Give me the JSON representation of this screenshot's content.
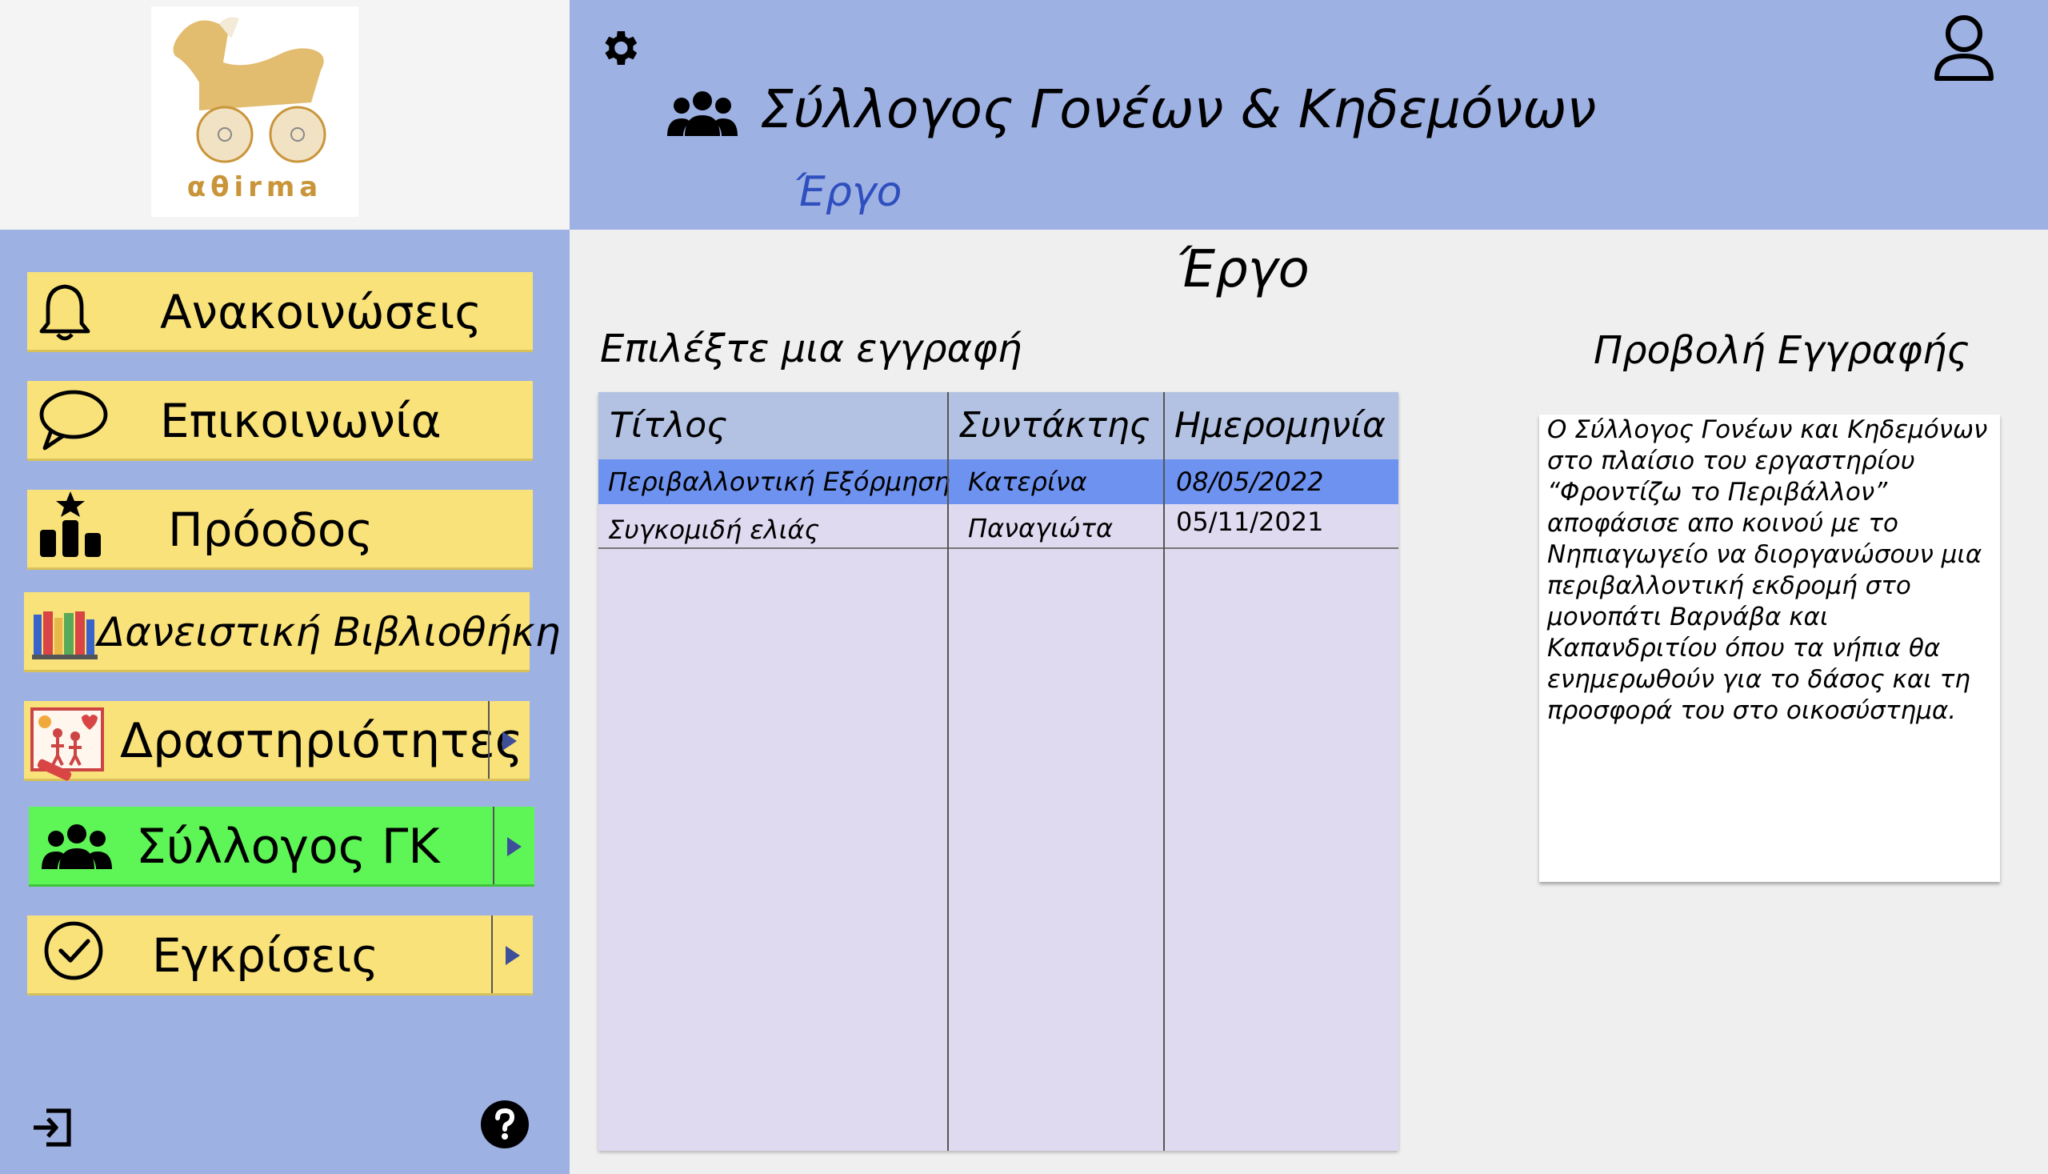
{
  "logo": {
    "text": "αθirma"
  },
  "header": {
    "title": "Σύλλογος Γονέων & Κηδεμόνων",
    "breadcrumb": "Έργο"
  },
  "colors": {
    "header_bg": "#9eb1e3",
    "nav_bg": "#f9e27a",
    "nav_active_bg": "#5ef556",
    "selected_row": "#6e92ef",
    "breadcrumb": "#2f4fbf"
  },
  "sidebar": {
    "items": [
      {
        "label": "Ανακοινώσεις",
        "icon": "bell-icon"
      },
      {
        "label": "Επικοινωνία",
        "icon": "speech-bubble-icon"
      },
      {
        "label": "Πρόοδος",
        "icon": "podium-star-icon"
      },
      {
        "label": "Δανειστική Βιβλιοθήκη",
        "icon": "books-icon"
      },
      {
        "label": "Δραστηριότητες",
        "icon": "drawing-icon",
        "submenu": true
      },
      {
        "label": "Σύλλογος ΓΚ",
        "icon": "group-icon",
        "submenu": true,
        "active": true
      },
      {
        "label": "Εγκρίσεις",
        "icon": "check-circle-icon",
        "submenu": true
      }
    ]
  },
  "main": {
    "page_title": "Έργο",
    "list_heading": "Επιλέξτε μια εγγραφή",
    "preview_heading": "Προβολή Εγγραφής",
    "table": {
      "columns": [
        "Τίτλος",
        "Συντάκτης",
        "Ημερομηνία"
      ],
      "rows": [
        {
          "title": "Περιβαλλοντική Εξόρμηση",
          "author": "Κατερίνα",
          "date": "08/05/2022",
          "selected": true
        },
        {
          "title": "Συγκομιδή ελιάς",
          "author": "Παναγιώτα",
          "date": "05/11/2021",
          "selected": false
        }
      ]
    },
    "preview_text": "Ο Σύλλογος Γονέων και Κηδεμόνων\nστο πλαίσιο του εργαστηρίου\n“Φροντίζω το Περιβάλλον”\nαποφάσισε απο κοινού με το\nΝηπιαγωγείο να διοργανώσουν μια\nπεριβαλλοντική εκδρομή στο\nμονοπάτι Βαρνάβα και\nΚαπανδριτίου όπου τα νήπια θα\nενημερωθούν για το δάσος και τη\nπροσφορά του στο οικοσύστημα."
  }
}
